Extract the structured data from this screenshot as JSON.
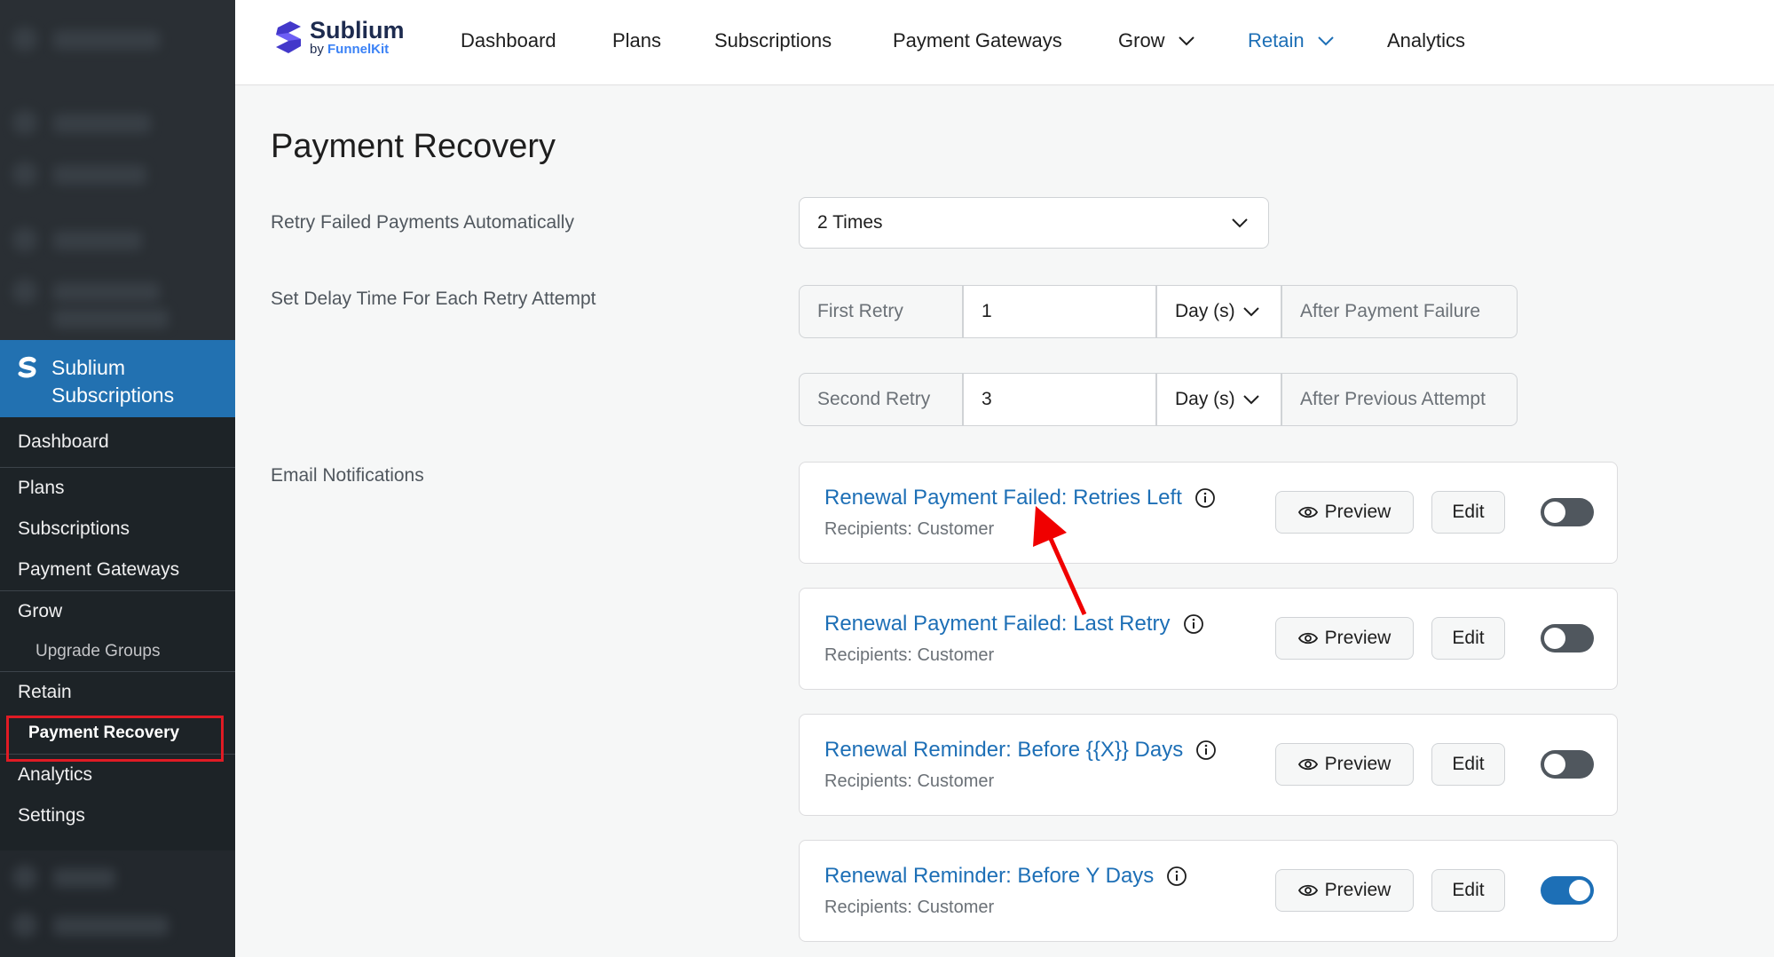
{
  "header": {
    "logo": {
      "name": "Sublium",
      "by": "by ",
      "by_brand": "FunnelKit"
    },
    "nav": [
      {
        "label": "Dashboard"
      },
      {
        "label": "Plans"
      },
      {
        "label": "Subscriptions"
      },
      {
        "label": "Payment Gateways"
      },
      {
        "label": "Grow"
      },
      {
        "label": "Retain"
      },
      {
        "label": "Analytics"
      }
    ],
    "active_nav": "Retain"
  },
  "sidebar": {
    "brand": "Sublium Subscriptions",
    "items": [
      {
        "label": "Dashboard"
      },
      {
        "label": "Plans"
      },
      {
        "label": "Subscriptions"
      },
      {
        "label": "Payment Gateways"
      },
      {
        "label": "Grow"
      },
      {
        "label": "Upgrade Groups"
      },
      {
        "label": "Retain"
      },
      {
        "label": "Payment Recovery"
      },
      {
        "label": "Analytics"
      },
      {
        "label": "Settings"
      }
    ]
  },
  "main": {
    "title": "Payment Recovery",
    "retry_label": "Retry Failed Payments Automatically",
    "retry_value": "2 Times",
    "delay_label": "Set Delay Time For Each Retry Attempt",
    "retries": [
      {
        "name": "First Retry",
        "value": "1",
        "unit": "Day (s)",
        "suffix": "After Payment Failure"
      },
      {
        "name": "Second Retry",
        "value": "3",
        "unit": "Day (s)",
        "suffix": "After Previous Attempt"
      }
    ],
    "email_label": "Email Notifications",
    "emails": [
      {
        "title": "Renewal Payment Failed: Retries Left",
        "recipients": "Recipients: Customer",
        "preview": "Preview",
        "edit": "Edit",
        "enabled": false
      },
      {
        "title": "Renewal Payment Failed: Last Retry",
        "recipients": "Recipients: Customer",
        "preview": "Preview",
        "edit": "Edit",
        "enabled": false
      },
      {
        "title": "Renewal Reminder: Before {{X}} Days",
        "recipients": "Recipients: Customer",
        "preview": "Preview",
        "edit": "Edit",
        "enabled": false
      },
      {
        "title": "Renewal Reminder: Before Y Days",
        "recipients": "Recipients: Customer",
        "preview": "Preview",
        "edit": "Edit",
        "enabled": true
      }
    ]
  },
  "colors": {
    "accent": "#1d6fb6",
    "sidebar": "#1d2327",
    "brand_block": "#2271b1",
    "highlight": "#e01b24",
    "arrow": "#f00000"
  }
}
